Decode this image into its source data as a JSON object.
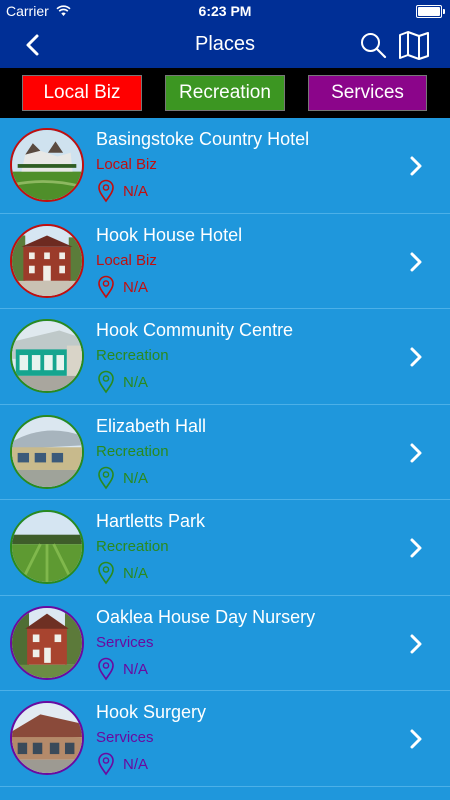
{
  "status_bar": {
    "carrier": "Carrier",
    "time": "6:23 PM"
  },
  "nav": {
    "title": "Places"
  },
  "filters": [
    {
      "label": "Local Biz",
      "color": "#ff0000"
    },
    {
      "label": "Recreation",
      "color": "#3c9622"
    },
    {
      "label": "Services",
      "color": "#8b058a"
    }
  ],
  "places": [
    {
      "name": "Basingstoke Country Hotel",
      "category": "Local Biz",
      "address": "N/A",
      "color": "#c20e0e"
    },
    {
      "name": "Hook House Hotel",
      "category": "Local Biz",
      "address": "N/A",
      "color": "#c20e0e"
    },
    {
      "name": "Hook Community Centre",
      "category": "Recreation",
      "address": "N/A",
      "color": "#2a8a1e"
    },
    {
      "name": "Elizabeth Hall",
      "category": "Recreation",
      "address": "N/A",
      "color": "#2a8a1e"
    },
    {
      "name": "Hartletts Park",
      "category": "Recreation",
      "address": "N/A",
      "color": "#2a8a1e"
    },
    {
      "name": "Oaklea House Day Nursery",
      "category": "Services",
      "address": "N/A",
      "color": "#6a0aa0"
    },
    {
      "name": "Hook Surgery",
      "category": "Services",
      "address": "N/A",
      "color": "#6a0aa0"
    }
  ]
}
